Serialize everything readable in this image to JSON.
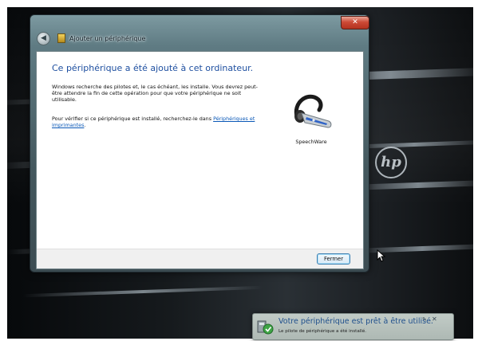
{
  "window": {
    "title": "Ajouter un périphérique",
    "close_glyph": "✕"
  },
  "content": {
    "heading": "Ce périphérique a été ajouté à cet ordinateur.",
    "paragraph1": "Windows recherche des pilotes et, le cas échéant, les installe. Vous devrez peut-être attendre la fin de cette opération pour que votre périphérique ne soit utilisable.",
    "paragraph2_text": "Pour vérifier si ce périphérique est installé, recherchez-le dans ",
    "paragraph2_link": "Périphériques et imprimantes",
    "paragraph2_end": ".",
    "device_name": "SpeechWare",
    "device_icon": "headset-icon"
  },
  "footer": {
    "close_button": "Fermer"
  },
  "desktop": {
    "logo_text": "hp"
  },
  "notification": {
    "title": "Votre périphérique est prêt à être utilisé.",
    "subtitle": "Le pilote de périphérique a été installé.",
    "pin_glyph": "✎",
    "close_glyph": "✕",
    "icon": "device-driver-icon"
  }
}
